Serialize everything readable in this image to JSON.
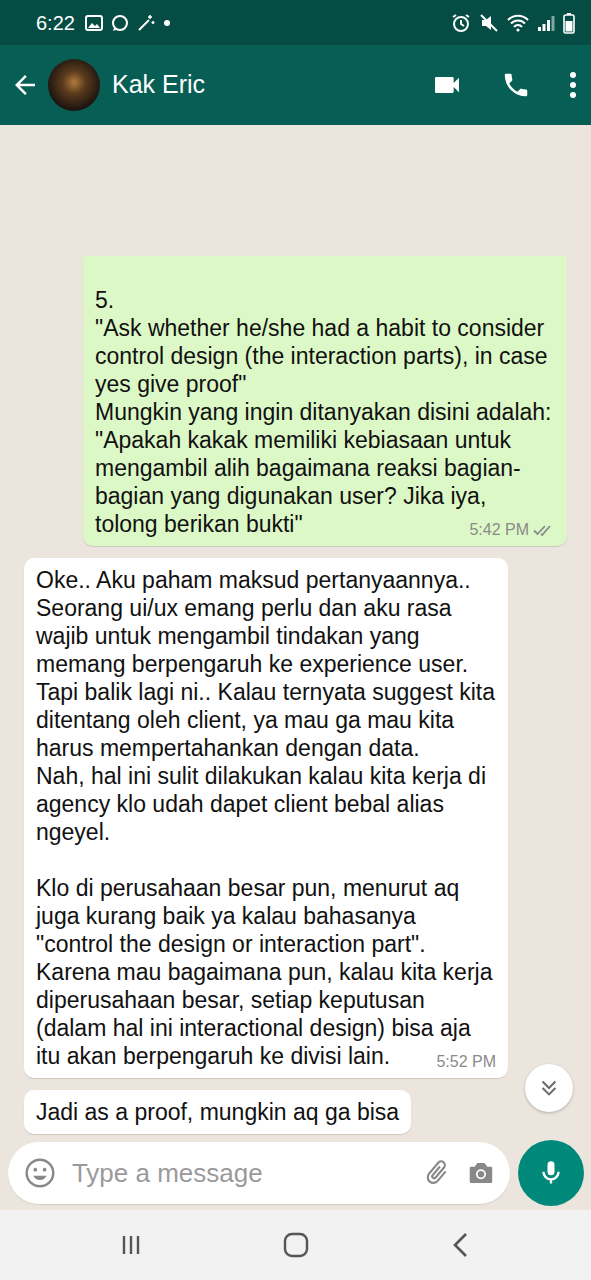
{
  "status_bar": {
    "time": "6:22"
  },
  "header": {
    "contact_name": "Kak Eric"
  },
  "messages": [
    {
      "kind": "outgoing",
      "text": "5.\n\"Ask whether he/she had a habit to consider control design (the interaction parts), in case yes give proof\"\nMungkin yang ingin ditanyakan disini adalah:\n\"Apakah kakak memiliki kebiasaan untuk mengambil alih bagaimana reaksi bagian-bagian yang digunakan user? Jika iya, tolong berikan bukti\"",
      "time": "5:42 PM",
      "read": false
    },
    {
      "kind": "incoming",
      "text": "Oke.. Aku paham maksud pertanyaannya..\nSeorang ui/ux emang perlu dan aku rasa wajib untuk mengambil tindakan yang memang berpengaruh ke experience user.\nTapi balik lagi ni.. Kalau ternyata suggest kita ditentang oleh client, ya mau ga mau kita harus mempertahankan dengan data.\nNah, hal ini sulit dilakukan kalau kita kerja di agency klo udah dapet client bebal alias ngeyel.\n\nKlo di perusahaan besar pun, menurut aq juga kurang baik ya kalau bahasanya \"control the design or interaction part\".\nKarena mau bagaimana pun, kalau kita kerja diperusahaan besar, setiap keputusan (dalam hal ini interactional design) bisa aja itu akan berpengaruh ke divisi lain.",
      "time": "5:52 PM"
    },
    {
      "kind": "incoming",
      "text": "Jadi as a proof, mungkin aq ga bisa"
    }
  ],
  "composer": {
    "placeholder": "Type a message"
  }
}
